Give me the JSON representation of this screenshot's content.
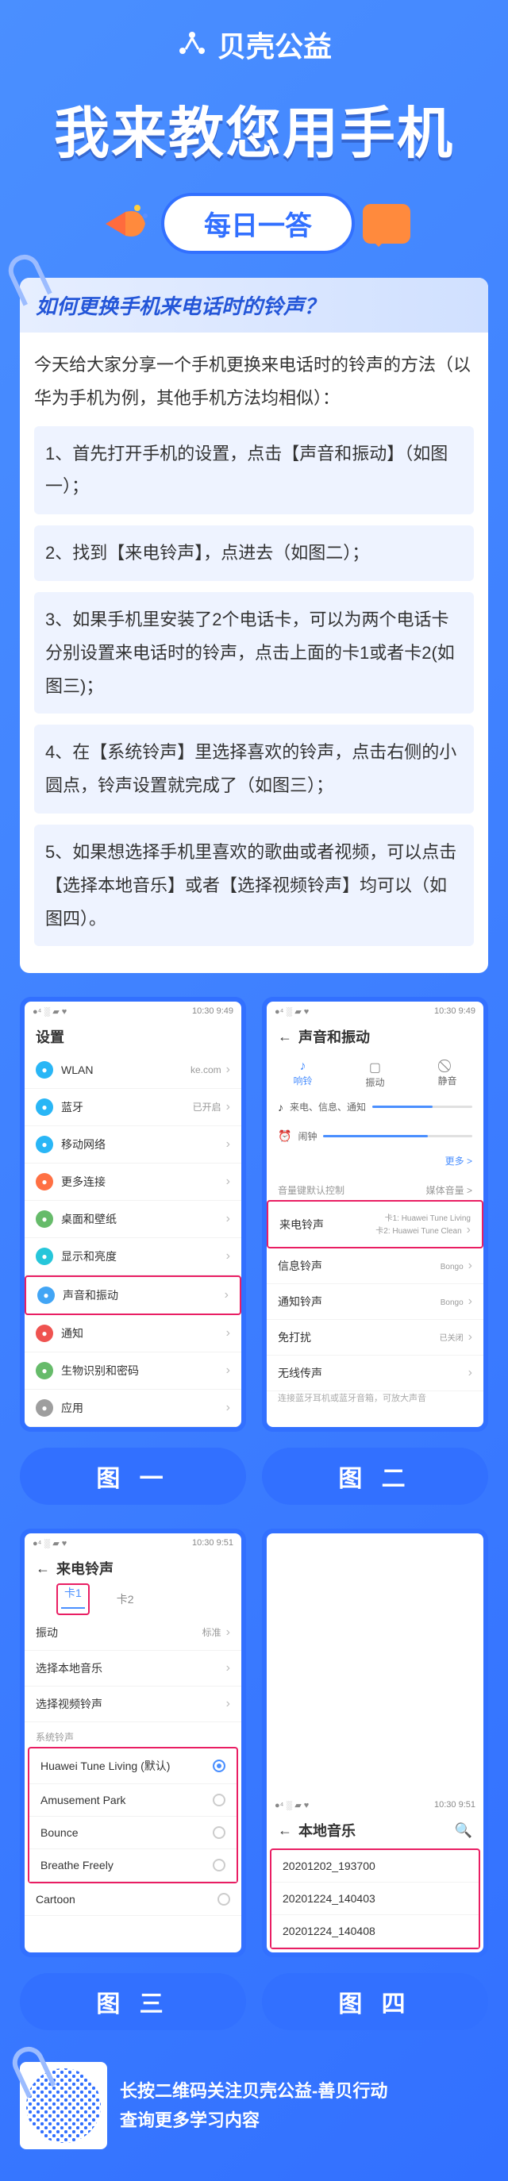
{
  "brand": "贝壳公益",
  "mainTitle": "我来教您用手机",
  "dailyBadge": "每日一答",
  "question": "如何更换手机来电话时的铃声？",
  "intro": "今天给大家分享一个手机更换来电话时的铃声的方法（以华为手机为例，其他手机方法均相似）：",
  "steps": [
    "1、首先打开手机的设置，点击【声音和振动】（如图一）；",
    "2、找到【来电铃声】，点进去（如图二）；",
    "3、如果手机里安装了2个电话卡，可以为两个电话卡分别设置来电话时的铃声，点击上面的卡1或者卡2(如图三)；",
    "4、在【系统铃声】里选择喜欢的铃声，点击右侧的小圆点，铃声设置就完成了（如图三）；",
    "5、如果想选择手机里喜欢的歌曲或者视频，可以点击【选择本地音乐】或者【选择视频铃声】均可以（如图四）。"
  ],
  "statusTime": "10:30 9:49",
  "statusTime2": "10:30 9:51",
  "fig1": {
    "title": "设置",
    "items": [
      {
        "icon": "#29b6f6",
        "label": "WLAN",
        "val": "ke.com"
      },
      {
        "icon": "#29b6f6",
        "label": "蓝牙",
        "val": "已开启"
      },
      {
        "icon": "#29b6f6",
        "label": "移动网络",
        "val": ""
      },
      {
        "icon": "#ff7043",
        "label": "更多连接",
        "val": ""
      },
      {
        "icon": "#66bb6a",
        "label": "桌面和壁纸",
        "val": ""
      },
      {
        "icon": "#26c6da",
        "label": "显示和亮度",
        "val": ""
      },
      {
        "icon": "#42a5f5",
        "label": "声音和振动",
        "val": "",
        "hl": true
      },
      {
        "icon": "#ef5350",
        "label": "通知",
        "val": ""
      },
      {
        "icon": "#66bb6a",
        "label": "生物识别和密码",
        "val": ""
      },
      {
        "icon": "#9e9e9e",
        "label": "应用",
        "val": ""
      }
    ]
  },
  "fig2": {
    "title": "声音和振动",
    "modes": [
      {
        "icon": "♪",
        "label": "响铃",
        "active": true
      },
      {
        "icon": "▢",
        "label": "振动"
      },
      {
        "icon": "⃠",
        "label": "静音"
      }
    ],
    "sliders": [
      {
        "icon": "♪",
        "label": "来电、信息、通知",
        "fill": 60
      },
      {
        "icon": "⏰",
        "label": "闹钟",
        "fill": 70
      }
    ],
    "moreLabel": "更多 >",
    "secHeader": {
      "l": "音量键默认控制",
      "r": "媒体音量 >"
    },
    "rows": [
      {
        "label": "来电铃声",
        "val": "卡1: Huawei Tune Living\n卡2: Huawei Tune Clean",
        "hl": true
      },
      {
        "label": "信息铃声",
        "val": "Bongo"
      },
      {
        "label": "通知铃声",
        "val": "Bongo"
      },
      {
        "label": "免打扰",
        "val": "已关闭"
      },
      {
        "label": "无线传声",
        "val": ""
      }
    ],
    "note": "连接蓝牙耳机或蓝牙音箱，可放大声音"
  },
  "fig3": {
    "title": "来电铃声",
    "tabs": [
      {
        "label": "卡1",
        "active": true
      },
      {
        "label": "卡2"
      }
    ],
    "rows": [
      {
        "label": "振动",
        "val": "标准"
      },
      {
        "label": "选择本地音乐",
        "val": ""
      },
      {
        "label": "选择视频铃声",
        "val": ""
      }
    ],
    "sysHeader": "系统铃声",
    "sys": [
      {
        "label": "Huawei Tune Living (默认)",
        "on": true
      },
      {
        "label": "Amusement Park",
        "on": false
      },
      {
        "label": "Bounce",
        "on": false
      },
      {
        "label": "Breathe Freely",
        "on": false
      }
    ],
    "extra": "Cartoon"
  },
  "fig4": {
    "title": "本地音乐",
    "files": [
      "20201202_193700",
      "20201224_140403",
      "20201224_140408"
    ]
  },
  "figLabels": [
    "图 一",
    "图 二",
    "图 三",
    "图 四"
  ],
  "footer": {
    "line1": "长按二维码关注贝壳公益-善贝行动",
    "line2": "查询更多学习内容"
  }
}
